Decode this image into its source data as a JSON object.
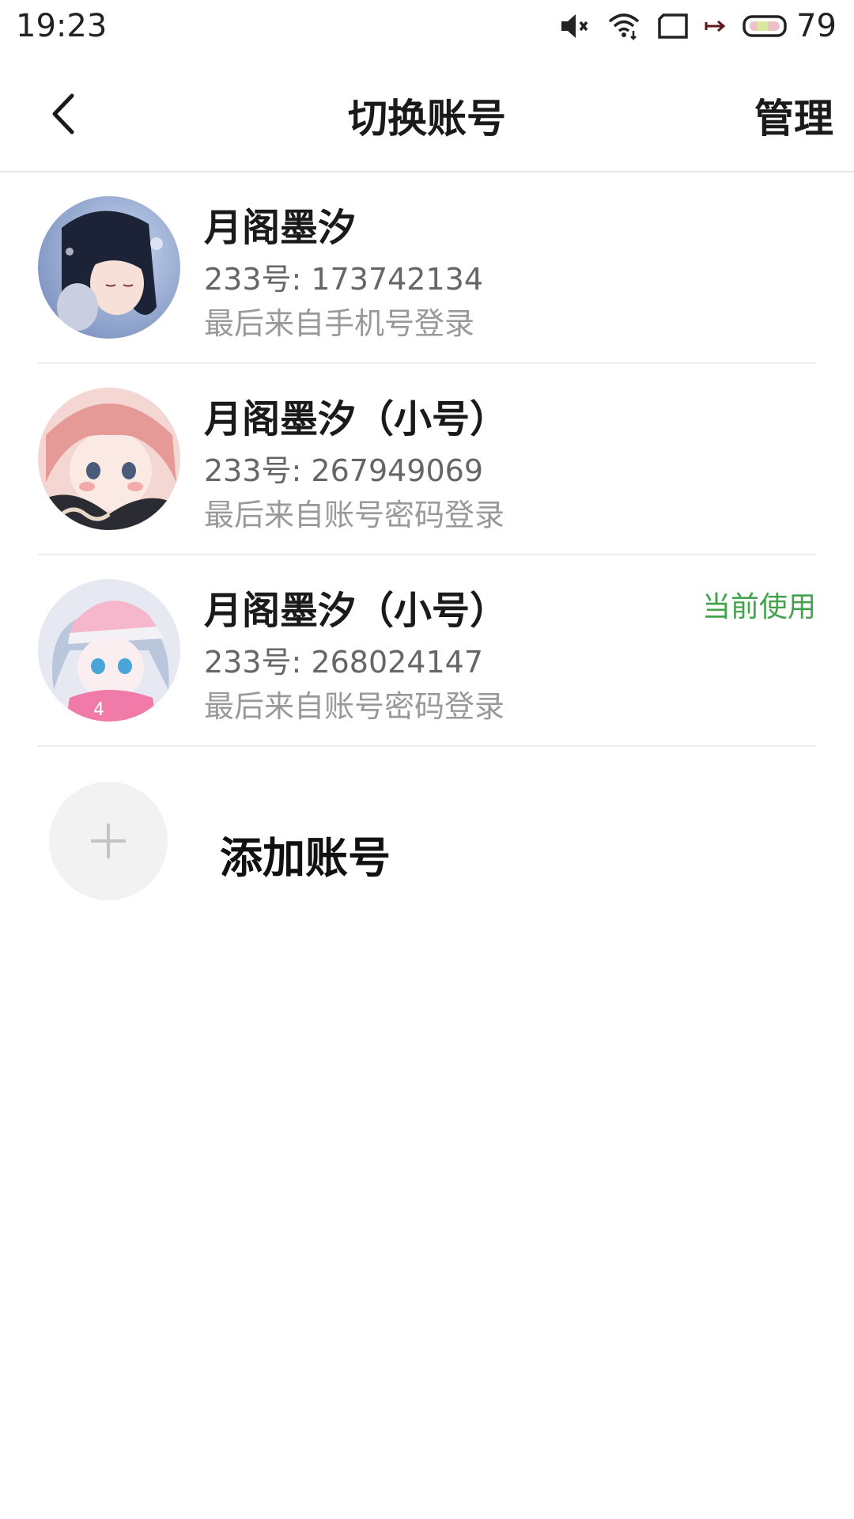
{
  "status_bar": {
    "time": "19:23",
    "battery_level": "79",
    "icons": [
      "mute-icon",
      "wifi-icon",
      "screen-icon",
      "arrow-icon",
      "battery-icon"
    ]
  },
  "header": {
    "title": "切换账号",
    "manage_label": "管理"
  },
  "accounts": [
    {
      "name": "月阁墨汐",
      "id_text": "233号: 173742134",
      "login_text": "最后来自手机号登录",
      "current": false
    },
    {
      "name": "月阁墨汐（小号）",
      "id_text": "233号: 267949069",
      "login_text": "最后来自账号密码登录",
      "current": false
    },
    {
      "name": "月阁墨汐（小号）",
      "id_text": "233号: 268024147",
      "login_text": "最后来自账号密码登录",
      "current": true,
      "current_label": "当前使用"
    }
  ],
  "add_account": {
    "label": "添加账号"
  },
  "colors": {
    "accent_green": "#43a34c",
    "divider": "#ececec"
  }
}
